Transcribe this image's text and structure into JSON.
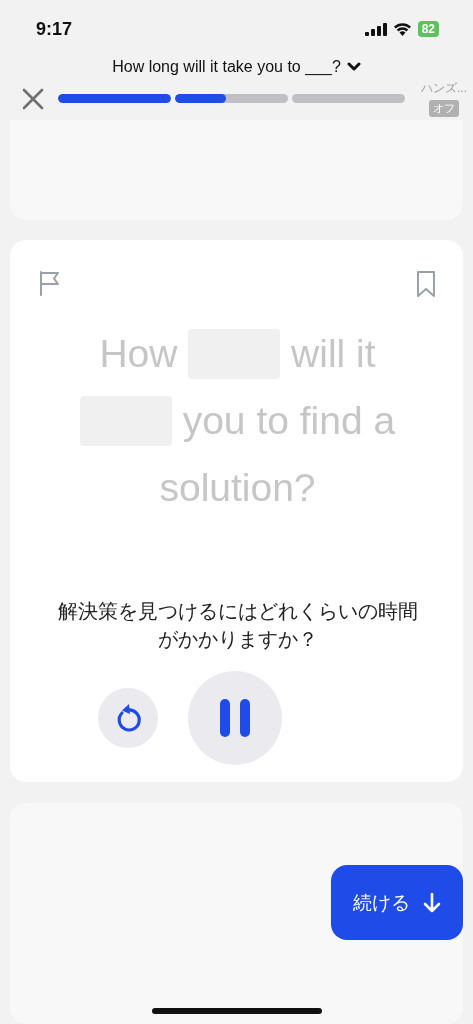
{
  "status_bar": {
    "time": "9:17",
    "battery": "82"
  },
  "header": {
    "title": "How long will it take you to ___?",
    "progress": [
      {
        "kind": "meter",
        "level": 1
      },
      {
        "kind": "meter",
        "level": 0.45
      },
      {
        "kind": "upcoming"
      }
    ],
    "hands_free": {
      "label": "ハンズ...",
      "state": "オフ",
      "on": false
    }
  },
  "card": {
    "bookmarked": false,
    "playing": true,
    "sentence": [
      {
        "kind": "word",
        "text": "How"
      },
      {
        "kind": "blank"
      },
      {
        "kind": "word",
        "text": "will it"
      },
      {
        "kind": "blank"
      },
      {
        "kind": "word",
        "text": "you to find a solution?"
      }
    ],
    "translation": "解決策を見つけるにはどれくらいの時間がかかりますか？"
  },
  "continue_button": {
    "label": "続ける"
  }
}
